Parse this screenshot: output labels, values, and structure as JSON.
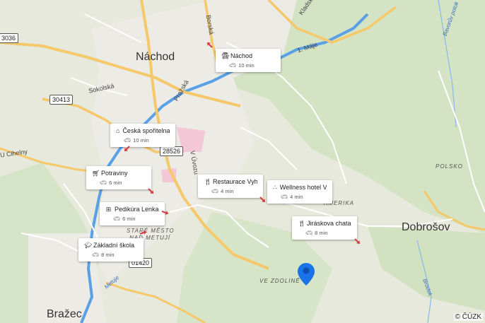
{
  "map": {
    "towns": {
      "nachod": "Náchod",
      "dobrosov": "Dobrošov",
      "brazec": "Bražec"
    },
    "areas": {
      "polsko": "POLSKO",
      "amerika": "AMERIKA",
      "stare_mesto_1": "STARÉ MĚSTO",
      "stare_mesto_2": "NAD METUJÍ",
      "ve_zdoline": "VE ZDOLINĚ"
    },
    "streets": {
      "borska": "Borská",
      "kladska": "Kladská",
      "prazska": "Pražská",
      "sokolska": "Sokolská",
      "cihelny": "U Cihelny",
      "u_vrby": "V Úvozu",
      "maje": "1. Máje",
      "bavoruv_potok": "Bavorův potok",
      "brodek": "Brodek",
      "metuje": "Metuje"
    },
    "road_shields": {
      "r3036": "3036",
      "r30413": "30413",
      "r28526": "28526",
      "r01420": "01420"
    },
    "copyright": "© ČÚZK"
  },
  "pois": [
    {
      "name": "Náchod",
      "time": "10 min",
      "icon": "bus-icon"
    },
    {
      "name": "Česká spořitelna",
      "time": "10 min",
      "icon": "bank-icon"
    },
    {
      "name": "Potraviny",
      "time": "6 min",
      "icon": "cart-icon"
    },
    {
      "name": "Restaurace Vyhlí...",
      "time": "4 min",
      "icon": "restaurant-icon"
    },
    {
      "name": "Wellness hotel Vy...",
      "time": "4 min",
      "icon": "hotel-icon"
    },
    {
      "name": "Pedikúra Lenka",
      "time": "6 min",
      "icon": "medical-icon"
    },
    {
      "name": "Jiráskova chata",
      "time": "8 min",
      "icon": "restaurant-icon"
    },
    {
      "name": "Základní škola",
      "time": "8 min",
      "icon": "school-icon"
    }
  ],
  "colors": {
    "road": "#ffffff",
    "main_road": "#f5c86b",
    "river": "#5aa0e6",
    "pin": "#1a73e8",
    "forest": "#cfe0bf"
  }
}
